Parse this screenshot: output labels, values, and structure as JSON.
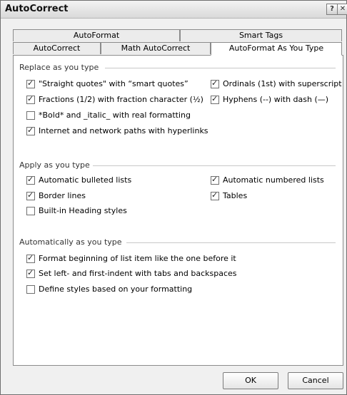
{
  "window": {
    "title": "AutoCorrect",
    "help_icon": "?",
    "close_icon": "✕"
  },
  "tabs_row1": [
    "AutoFormat",
    "Smart Tags"
  ],
  "tabs_row2": [
    "AutoCorrect",
    "Math AutoCorrect",
    "AutoFormat As You Type"
  ],
  "sections": [
    {
      "title": "Replace as you type",
      "items": [
        {
          "label": "\"Straight quotes\" with “smart quotes”",
          "checked": true
        },
        {
          "label": "Ordinals (1st) with superscript",
          "checked": true
        },
        {
          "label": "Fractions (1/2) with fraction character (½)",
          "checked": true
        },
        {
          "label": "Hyphens (--) with dash (—)",
          "checked": true
        },
        {
          "label": "*Bold* and _italic_ with real formatting",
          "checked": false
        },
        {
          "label": "Internet and network paths with hyperlinks",
          "checked": true
        }
      ]
    },
    {
      "title": "Apply as you type",
      "items": [
        {
          "label": "Automatic bulleted lists",
          "checked": true
        },
        {
          "label": "Automatic numbered lists",
          "checked": true
        },
        {
          "label": "Border lines",
          "checked": true
        },
        {
          "label": "Tables",
          "checked": true
        },
        {
          "label": "Built-in Heading styles",
          "checked": false
        }
      ]
    },
    {
      "title": "Automatically as you type",
      "items": [
        {
          "label": "Format beginning of list item like the one before it",
          "checked": true
        },
        {
          "label": "Set left- and first-indent with tabs and backspaces",
          "checked": true
        },
        {
          "label": "Define styles based on your formatting",
          "checked": false
        }
      ]
    }
  ],
  "buttons": {
    "ok": "OK",
    "cancel": "Cancel"
  }
}
